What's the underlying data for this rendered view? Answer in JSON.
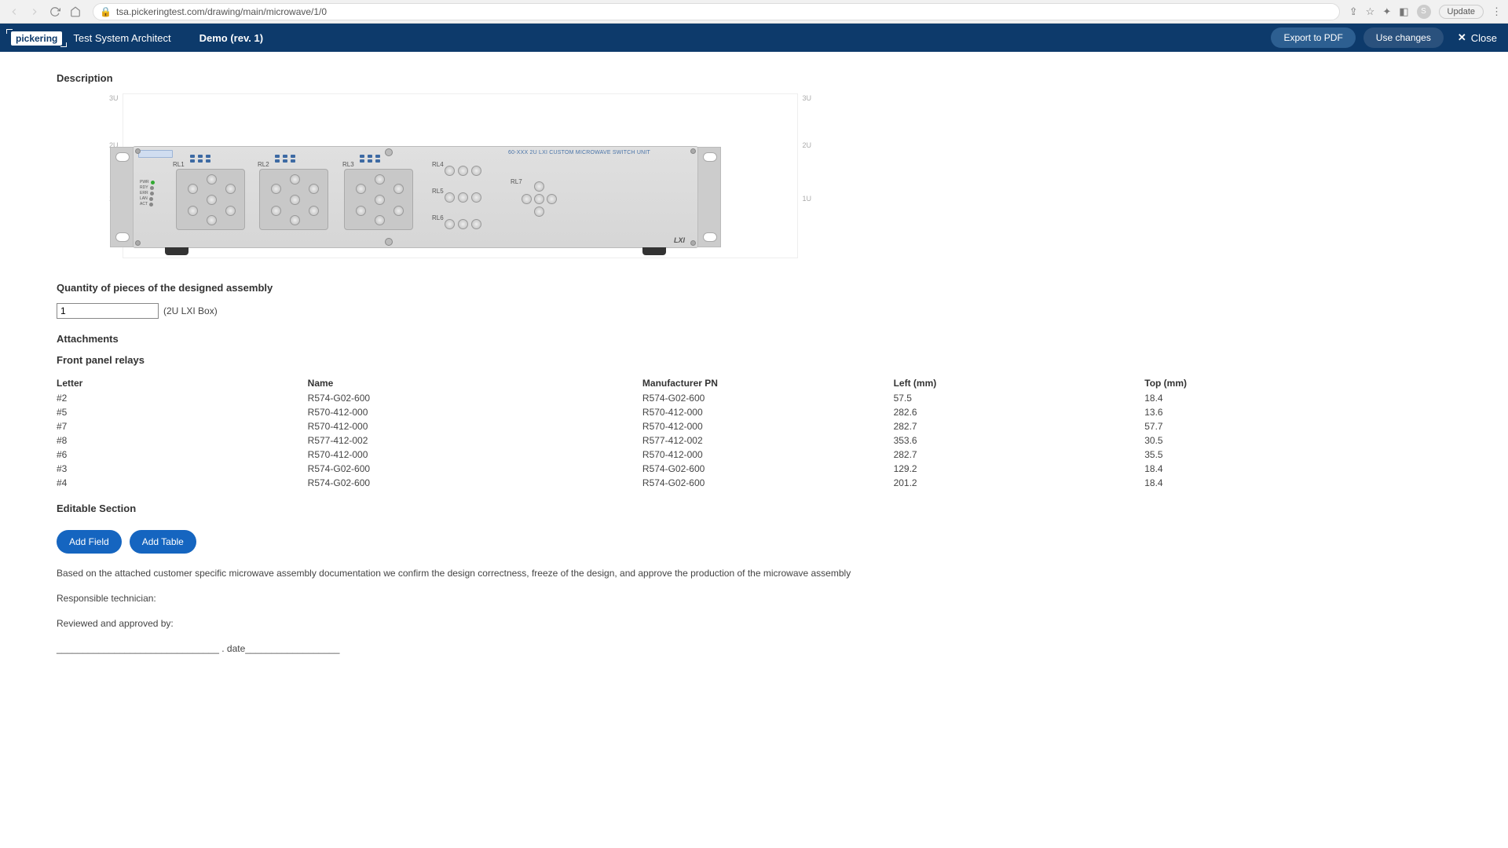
{
  "browser": {
    "url": "tsa.pickeringtest.com/drawing/main/microwave/1/0",
    "update_label": "Update",
    "avatar_letter": "S"
  },
  "header": {
    "logo_text": "pickering",
    "app_title": "Test System Architect",
    "doc_title": "Demo (rev. 1)",
    "export_label": "Export to PDF",
    "use_changes_label": "Use changes",
    "close_label": "Close"
  },
  "sections": {
    "description": "Description",
    "quantity": "Quantity of pieces of the designed assembly",
    "attachments": "Attachments",
    "relays": "Front panel relays",
    "editable": "Editable Section"
  },
  "device": {
    "u_labels": {
      "u3": "3U",
      "u2": "2U",
      "u1": "1U"
    },
    "rl_labels": {
      "rl1": "RL1",
      "rl2": "RL2",
      "rl3": "RL3",
      "rl4": "RL4",
      "rl5": "RL5",
      "rl6": "RL6",
      "rl7": "RL7"
    },
    "badge": "60-XXX 2U LXI CUSTOM MICROWAVE SWITCH UNIT",
    "lxi": "LXI",
    "status": [
      "PWR",
      "RDY",
      "ERR",
      "LAN",
      "ACT"
    ]
  },
  "quantity": {
    "value": "1",
    "note": "(2U LXI Box)"
  },
  "relay_table": {
    "headers": {
      "letter": "Letter",
      "name": "Name",
      "pn": "Manufacturer PN",
      "left": "Left (mm)",
      "top": "Top (mm)"
    },
    "rows": [
      {
        "letter": "#2",
        "name": "R574-G02-600",
        "pn": "R574-G02-600",
        "left": "57.5",
        "top": "18.4"
      },
      {
        "letter": "#5",
        "name": "R570-412-000",
        "pn": "R570-412-000",
        "left": "282.6",
        "top": "13.6"
      },
      {
        "letter": "#7",
        "name": "R570-412-000",
        "pn": "R570-412-000",
        "left": "282.7",
        "top": "57.7"
      },
      {
        "letter": "#8",
        "name": "R577-412-002",
        "pn": "R577-412-002",
        "left": "353.6",
        "top": "30.5"
      },
      {
        "letter": "#6",
        "name": "R570-412-000",
        "pn": "R570-412-000",
        "left": "282.7",
        "top": "35.5"
      },
      {
        "letter": "#3",
        "name": "R574-G02-600",
        "pn": "R574-G02-600",
        "left": "129.2",
        "top": "18.4"
      },
      {
        "letter": "#4",
        "name": "R574-G02-600",
        "pn": "R574-G02-600",
        "left": "201.2",
        "top": "18.4"
      }
    ]
  },
  "buttons": {
    "add_field": "Add Field",
    "add_table": "Add Table"
  },
  "text": {
    "confirm": "Based on the attached customer specific microwave assembly documentation we confirm the design correctness, freeze of the design, and approve the production of the microwave assembly",
    "tech": "Responsible technician:",
    "approved": "Reviewed and approved by:",
    "sign": "_______________________________ . date__________________"
  }
}
